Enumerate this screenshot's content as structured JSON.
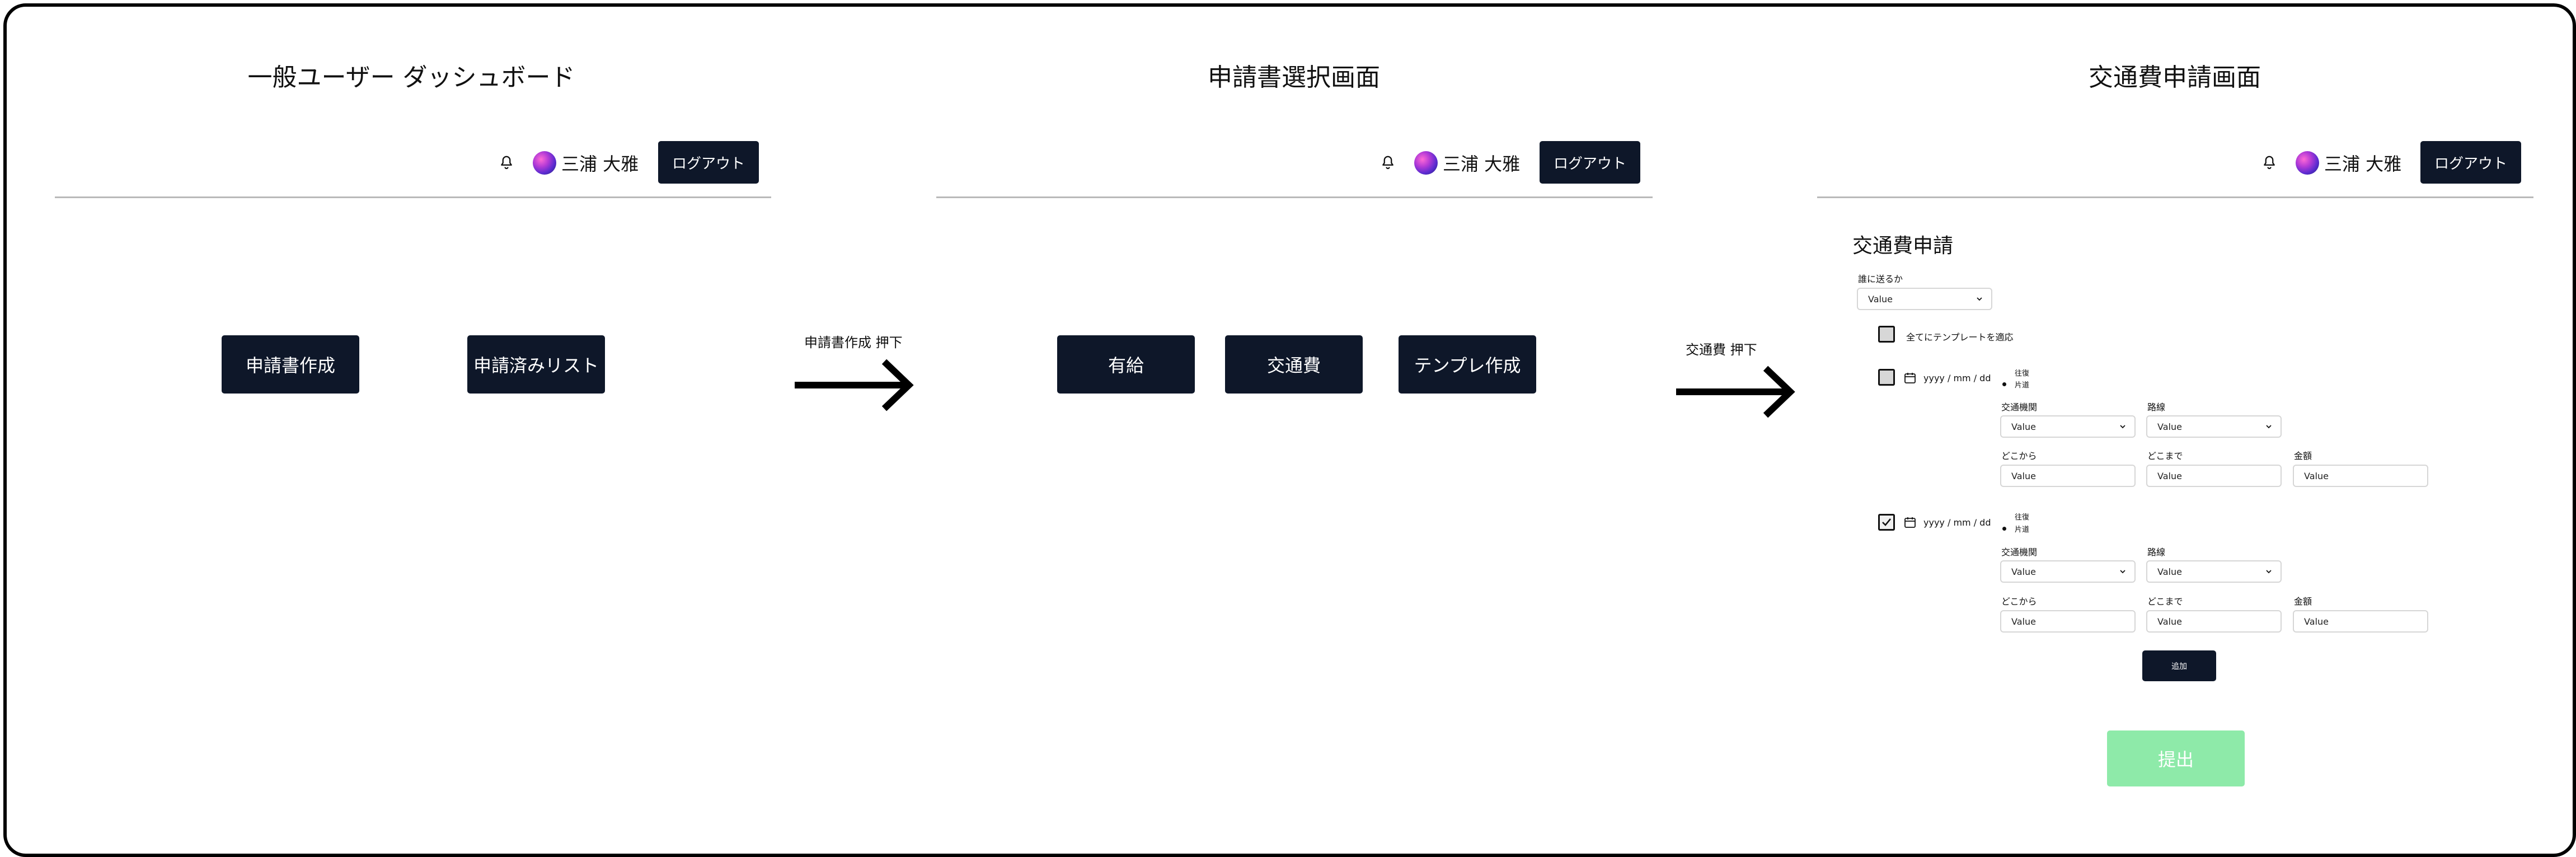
{
  "screens": [
    {
      "title": "一般ユーザー ダッシュボード",
      "header": {
        "username": "三浦 大雅",
        "logout_label": "ログアウト"
      },
      "buttons": [
        "申請書作成",
        "申請済みリスト"
      ]
    },
    {
      "title": "申請書選択画面",
      "header": {
        "username": "三浦 大雅",
        "logout_label": "ログアウト"
      },
      "buttons": [
        "有給",
        "交通費",
        "テンプレ作成"
      ]
    },
    {
      "title": "交通費申請画面",
      "header": {
        "username": "三浦 大雅",
        "logout_label": "ログアウト"
      },
      "form": {
        "title": "交通費申請",
        "recipient_label": "誰に送るか",
        "recipient_value": "Value",
        "apply_all_label": "全てにテンプレートを適応",
        "entries": [
          {
            "date_placeholder": "yyyy / mm / dd",
            "trip_options": [
              "往復",
              "片道"
            ],
            "selected_trip": "片道",
            "checked": false,
            "transport_label": "交通機関",
            "transport_value": "Value",
            "route_label": "路線",
            "route_value": "Value",
            "from_label": "どこから",
            "from_value": "Value",
            "to_label": "どこまで",
            "to_value": "Value",
            "amount_label": "金額",
            "amount_value": "Value"
          },
          {
            "date_placeholder": "yyyy / mm / dd",
            "trip_options": [
              "往復",
              "片道"
            ],
            "selected_trip": "片道",
            "checked": true,
            "transport_label": "交通機関",
            "transport_value": "Value",
            "route_label": "路線",
            "route_value": "Value",
            "from_label": "どこから",
            "from_value": "Value",
            "to_label": "どこまで",
            "to_value": "Value",
            "amount_label": "金額",
            "amount_value": "Value"
          }
        ],
        "add_label": "追加",
        "submit_label": "提出"
      }
    }
  ],
  "transitions": [
    {
      "label": "申請書作成 押下"
    },
    {
      "label": "交通費 押下"
    }
  ],
  "colors": {
    "dark_button": "#0e1729",
    "submit_disabled": "#8eeaa9",
    "divider": "#b9b9b9"
  },
  "icons": [
    "bell-icon",
    "avatar",
    "chevron-down-icon",
    "calendar-icon",
    "check-icon",
    "arrow-right-icon"
  ]
}
